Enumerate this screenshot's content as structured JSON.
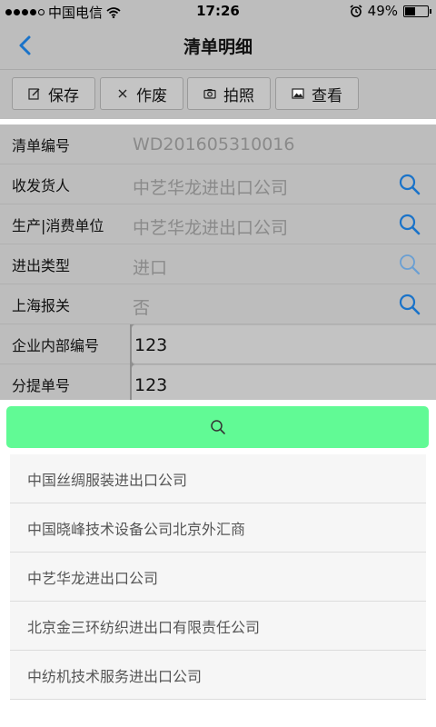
{
  "status_bar": {
    "carrier": "中国电信",
    "time": "17:26",
    "battery": "49%",
    "battery_level": 0.49
  },
  "nav": {
    "title": "清单明细",
    "back_icon": "chevron-left-icon"
  },
  "toolbar": {
    "buttons": [
      {
        "label": "保存",
        "icon": "edit-icon"
      },
      {
        "label": "作废",
        "icon": "close-icon"
      },
      {
        "label": "拍照",
        "icon": "camera-icon"
      },
      {
        "label": "查看",
        "icon": "image-icon"
      }
    ]
  },
  "form": {
    "rows": [
      {
        "label": "清单编号",
        "value": "WD201605310016"
      },
      {
        "label": "收发货人",
        "value": "中艺华龙进出口公司"
      },
      {
        "label": "生产|消费单位",
        "value": "中艺华龙进出口公司"
      },
      {
        "label": "进出类型",
        "value": "进口"
      },
      {
        "label": "上海报关",
        "value": "否"
      },
      {
        "label": "企业内部编号",
        "value": "123"
      },
      {
        "label": "分提单号",
        "value": "123"
      }
    ]
  },
  "picker": {
    "accent": "#61fa95",
    "items": [
      "中国丝绸服装进出口公司",
      "中国晓峰技术设备公司北京外汇商",
      "中艺华龙进出口公司",
      "北京金三环纺织进出口有限责任公司",
      "中纺机技术服务进出口公司"
    ]
  }
}
